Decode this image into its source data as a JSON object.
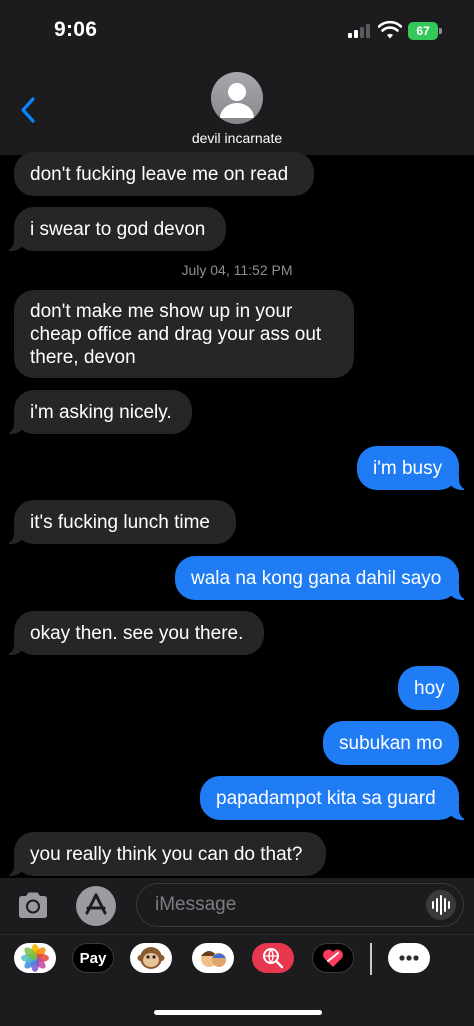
{
  "status_bar": {
    "time": "9:06",
    "battery": "67"
  },
  "header": {
    "contact_name": "devil incarnate"
  },
  "messages": [
    {
      "text": "don't fucking leave me on read",
      "direction": "in"
    },
    {
      "text": "i swear to god devon",
      "direction": "in"
    },
    {
      "text": "don't make me show up in your cheap office and drag your ass out there, devon",
      "direction": "in"
    },
    {
      "text": "i'm asking nicely.",
      "direction": "in"
    },
    {
      "text": "i'm busy",
      "direction": "out"
    },
    {
      "text": "it's fucking lunch time",
      "direction": "in"
    },
    {
      "text": "wala na kong gana dahil sayo",
      "direction": "out"
    },
    {
      "text": "okay then. see you there.",
      "direction": "in"
    },
    {
      "text": "hoy",
      "direction": "out"
    },
    {
      "text": "subukan mo",
      "direction": "out"
    },
    {
      "text": "papadampot kita sa guard",
      "direction": "out"
    },
    {
      "text": "you really think you can do that?",
      "direction": "in"
    }
  ],
  "timestamp": "July 04, 11:52 PM",
  "compose": {
    "placeholder": "iMessage",
    "value": ""
  },
  "app_drawer": {
    "items": [
      {
        "name": "photos",
        "icon": "photos-icon"
      },
      {
        "name": "apple-pay",
        "label": "Pay",
        "icon": "apple-pay-icon"
      },
      {
        "name": "animoji",
        "icon": "monkey-memoji-icon"
      },
      {
        "name": "memoji-stickers",
        "icon": "memoji-stickers-icon"
      },
      {
        "name": "images-search",
        "icon": "globe-search-icon"
      },
      {
        "name": "digital-touch",
        "icon": "heart-touch-icon"
      },
      {
        "name": "more",
        "icon": "more-icon"
      }
    ]
  },
  "colors": {
    "outgoing_bubble": "#1f7cf5",
    "incoming_bubble": "#262628",
    "battery": "#34c759",
    "link_blue": "#0a84ff"
  }
}
